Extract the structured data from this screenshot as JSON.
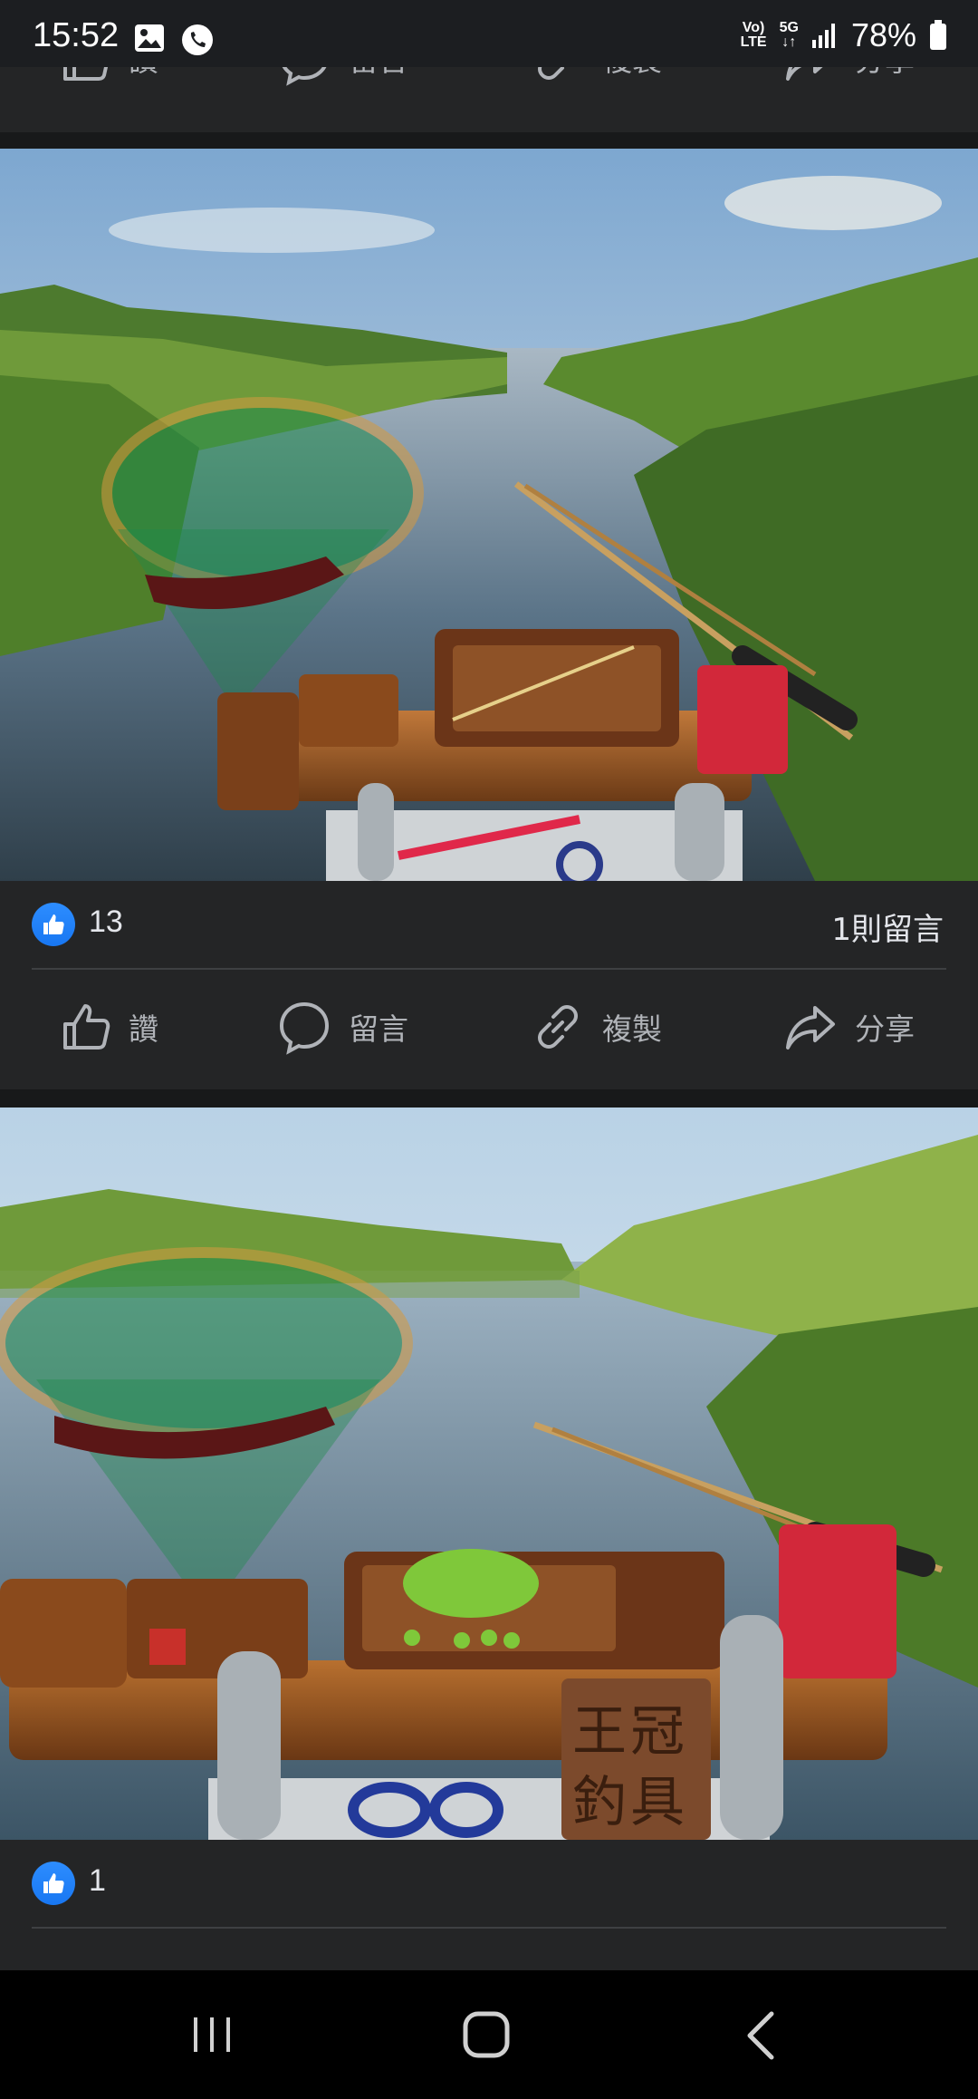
{
  "status_bar": {
    "time": "15:52",
    "network_top": "Vo)",
    "network_bottom": "LTE",
    "fiveg_top": "5G",
    "fiveg_bottom": "↓↑",
    "battery": "78%"
  },
  "actions": {
    "like": "讚",
    "comment": "留言",
    "copy": "複製",
    "share": "分享"
  },
  "posts": [
    {
      "like_count": "13",
      "comment_count": "1則留言"
    },
    {
      "like_count": "1"
    }
  ],
  "sign_text": [
    "王冠",
    "釣具"
  ],
  "icons": [
    "gallery-icon",
    "phone-icon",
    "signal-icon",
    "battery-icon",
    "like-icon",
    "comment-icon",
    "link-icon",
    "share-icon",
    "recent-apps-icon",
    "home-icon",
    "back-icon"
  ]
}
